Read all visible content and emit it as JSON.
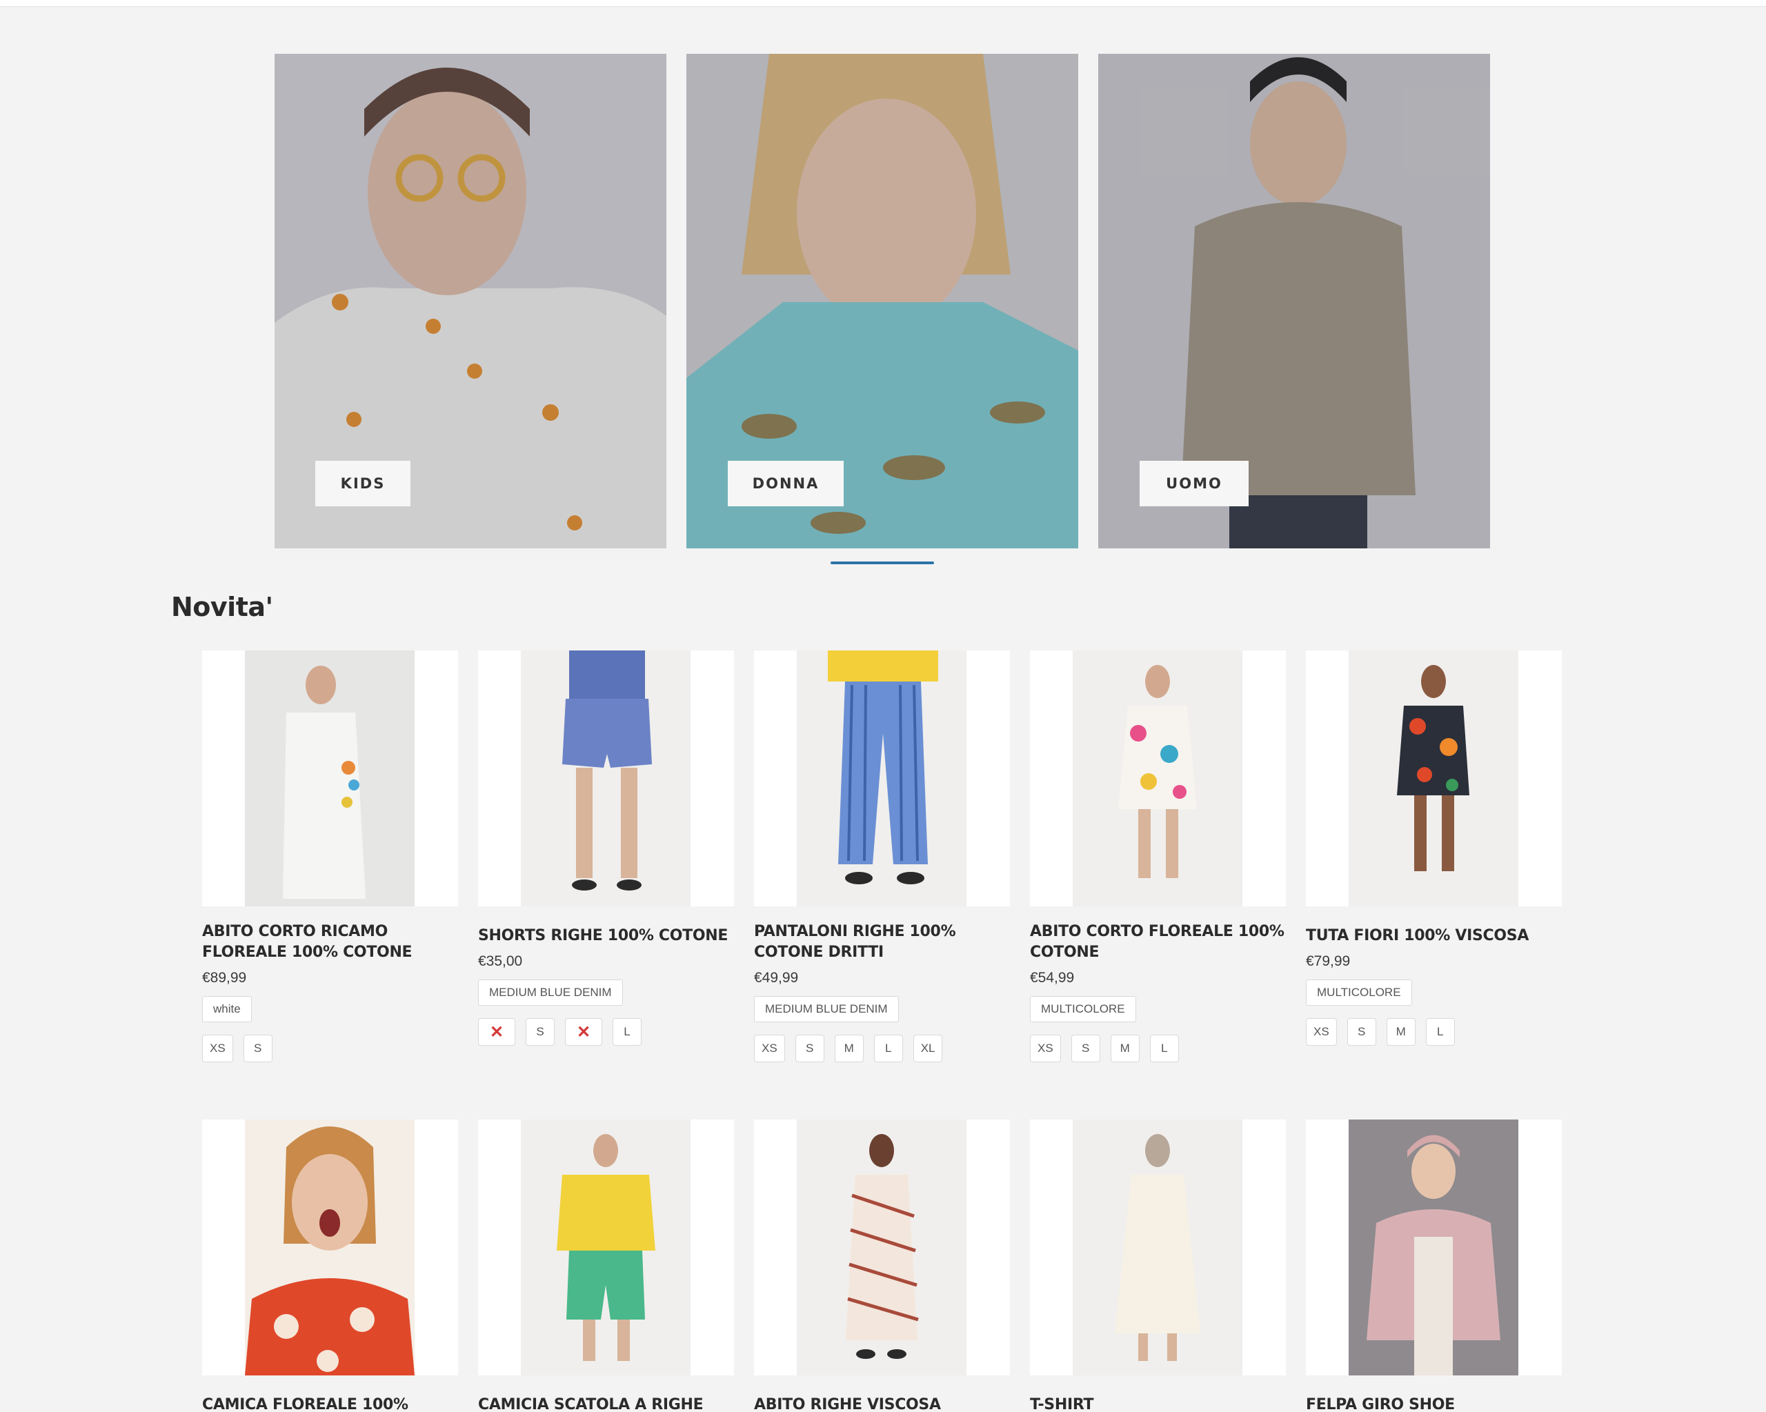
{
  "categories": [
    {
      "id": "kids",
      "label": "KIDS"
    },
    {
      "id": "donna",
      "label": "DONNA"
    },
    {
      "id": "uomo",
      "label": "UOMO"
    }
  ],
  "section_title": "Novita'",
  "products": [
    {
      "name": "ABITO CORTO RICAMO FLOREALE 100% COTONE",
      "price": "€89,99",
      "color": "white",
      "sizes": [
        "XS",
        "S"
      ]
    },
    {
      "name": "SHORTS RIGHE 100% COTONE",
      "price": "€35,00",
      "color": "MEDIUM BLUE DENIM",
      "sizes": [
        "✕",
        "S",
        "✕",
        "L"
      ]
    },
    {
      "name": "PANTALONI RIGHE 100% COTONE DRITTI",
      "price": "€49,99",
      "color": "MEDIUM BLUE DENIM",
      "sizes": [
        "XS",
        "S",
        "M",
        "L",
        "XL"
      ]
    },
    {
      "name": "ABITO CORTO FLOREALE 100% COTONE",
      "price": "€54,99",
      "color": "MULTICOLORE",
      "sizes": [
        "XS",
        "S",
        "M",
        "L"
      ]
    },
    {
      "name": "TUTA FIORI 100% VISCOSA",
      "price": "€79,99",
      "color": "MULTICOLORE",
      "sizes": [
        "XS",
        "S",
        "M",
        "L"
      ]
    },
    {
      "name": "CAMICA FLOREALE 100%"
    },
    {
      "name": "CAMICIA SCATOLA A RIGHE"
    },
    {
      "name": "ABITO RIGHE VISCOSA"
    },
    {
      "name": "T-SHIRT"
    },
    {
      "name": "FELPA GIRO SHOE"
    }
  ],
  "colors": {
    "background": "#f3f3f3",
    "accent": "#2a73a8",
    "unavailable": "#d23a3a"
  }
}
